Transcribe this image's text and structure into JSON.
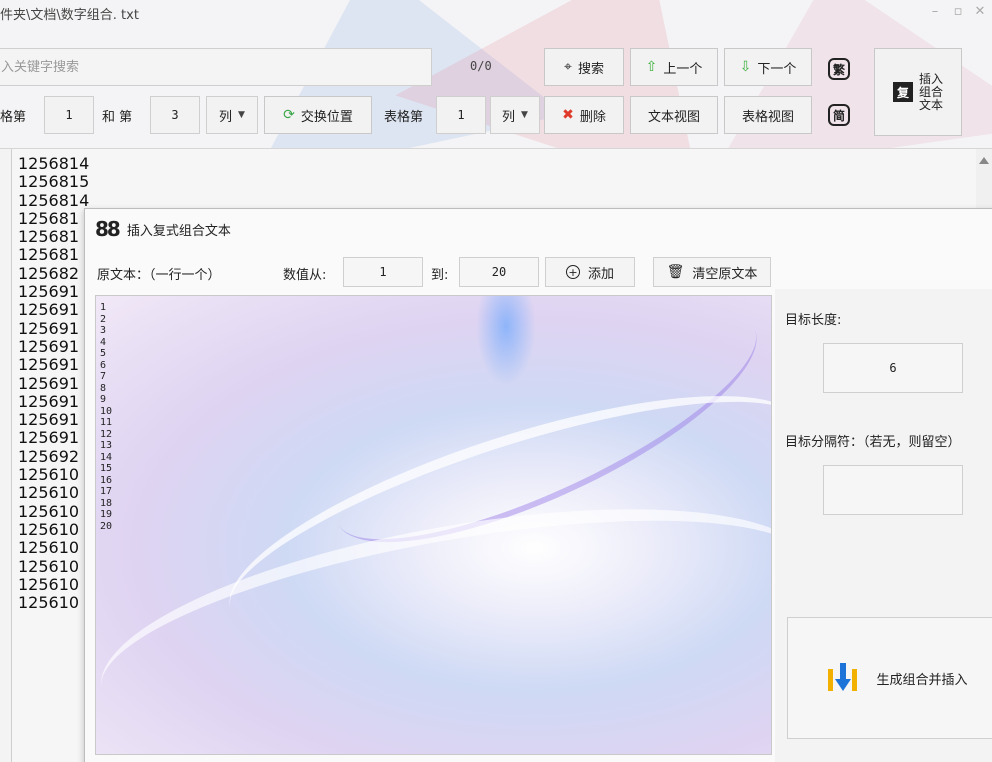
{
  "window": {
    "title": "件夹\\文档\\数字组合. txt",
    "minimize_glyph": "–",
    "maximize_glyph": "▫",
    "close_glyph": "✕"
  },
  "toolbar": {
    "search_placeholder": "入关键字搜索",
    "match_counter": "0/0",
    "search_button": "搜索",
    "prev_button": "上一个",
    "next_button": "下一个",
    "traditional_button": "繁",
    "simplified_button": "简",
    "insert_combo_button": "插入\n组合\n文本",
    "insert_combo_badge": "复",
    "swap_label_1": "格第",
    "swap_col_a": "1",
    "swap_label_and": "和 第",
    "swap_col_b": "3",
    "swap_unit": "列",
    "swap_button": "交换位置",
    "delete_label": "表格第",
    "delete_col": "1",
    "delete_unit": "列",
    "delete_button": "删除",
    "text_view_button": "文本视图",
    "table_view_button": "表格视图"
  },
  "editor": {
    "lines": [
      "1256814",
      "1256815",
      "1256814",
      "125681",
      "125681",
      "125681",
      "125682",
      "125691",
      "125691",
      "125691",
      "125691",
      "125691",
      "125691",
      "125691",
      "125691",
      "125691",
      "125692",
      "125610",
      "125610",
      "125610",
      "125610",
      "125610",
      "125610",
      "125610",
      "125610"
    ]
  },
  "dialog": {
    "title": "插入复式组合文本",
    "title_glyph": "88",
    "source_label": "原文本：（一行一个）",
    "range_from_label": "数值从:",
    "range_from_value": "1",
    "range_to_label": "到:",
    "range_to_value": "20",
    "add_button": "添加",
    "clear_button": "清空原文本",
    "source_lines": "1\n2\n3\n4\n5\n6\n7\n8\n9\n10\n11\n12\n13\n14\n15\n16\n17\n18\n19\n20",
    "target_length_label": "目标长度:",
    "target_length_value": "6",
    "separator_label": "目标分隔符：（若无，则留空）",
    "separator_value": "",
    "generate_button": "生成组合并插入"
  },
  "colors": {
    "prev_arrow": "#3db13d",
    "next_arrow": "#3db13d",
    "delete_x": "#e03a2a",
    "swap_icon": "#3aa64a",
    "generate_icon_yellow": "#f2b100",
    "generate_icon_blue": "#1e73d8"
  }
}
